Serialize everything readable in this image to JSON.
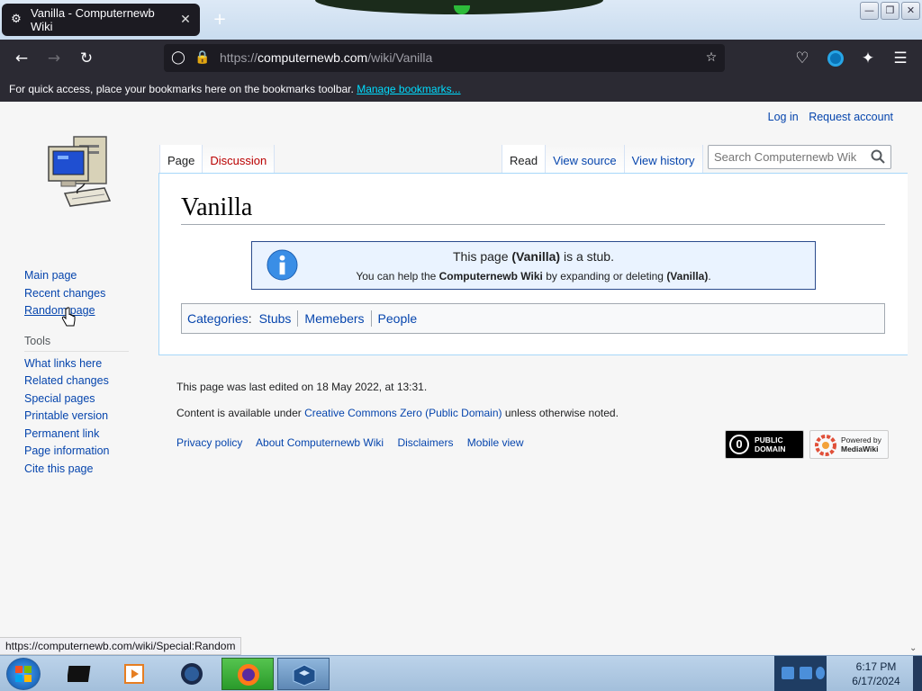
{
  "browser": {
    "tab_title": "Vanilla - Computernewb Wiki",
    "url_prefix": "https://",
    "url_host": "computernewb.com",
    "url_path": "/wiki/Vanilla",
    "bookmarks_text": "For quick access, place your bookmarks here on the bookmarks toolbar.",
    "bookmarks_link": "Manage bookmarks...",
    "status_url": "https://computernewb.com/wiki/Special:Random"
  },
  "personal": {
    "login": "Log in",
    "request_account": "Request account"
  },
  "tabs": {
    "page": "Page",
    "discussion": "Discussion",
    "read": "Read",
    "view_source": "View source",
    "view_history": "View history"
  },
  "search": {
    "placeholder": "Search Computernewb Wiki"
  },
  "sidebar": {
    "nav": [
      "Main page",
      "Recent changes",
      "Random page"
    ],
    "tools_heading": "Tools",
    "tools": [
      "What links here",
      "Related changes",
      "Special pages",
      "Printable version",
      "Permanent link",
      "Page information",
      "Cite this page"
    ]
  },
  "article": {
    "title": "Vanilla",
    "stub_line1_pre": "This page ",
    "stub_line1_bold": "(Vanilla)",
    "stub_line1_post": " is a stub.",
    "stub_line2_a": "You can help the ",
    "stub_line2_b": "Computernewb Wiki",
    "stub_line2_c": " by expanding or deleting ",
    "stub_line2_d": "(Vanilla)",
    "stub_line2_e": "."
  },
  "categories": {
    "label": "Categories",
    "items": [
      "Stubs",
      "Memebers",
      "People"
    ]
  },
  "footer": {
    "last_edited": "This page was last edited on 18 May 2022, at 13:31.",
    "license_pre": "Content is available under ",
    "license_link": "Creative Commons Zero (Public Domain)",
    "license_post": " unless otherwise noted.",
    "places": [
      "Privacy policy",
      "About Computernewb Wiki",
      "Disclaimers",
      "Mobile view"
    ],
    "pd_badge": [
      "PUBLIC",
      "DOMAIN"
    ],
    "mw_badge": [
      "Powered by",
      "MediaWiki"
    ]
  },
  "taskbar": {
    "time": "6:17 PM",
    "date": "6/17/2024"
  },
  "colors": {
    "link": "#0645ad",
    "new_link": "#ba0000",
    "browser_chrome": "#2b2a33",
    "stub_bg": "#eaf3ff"
  }
}
